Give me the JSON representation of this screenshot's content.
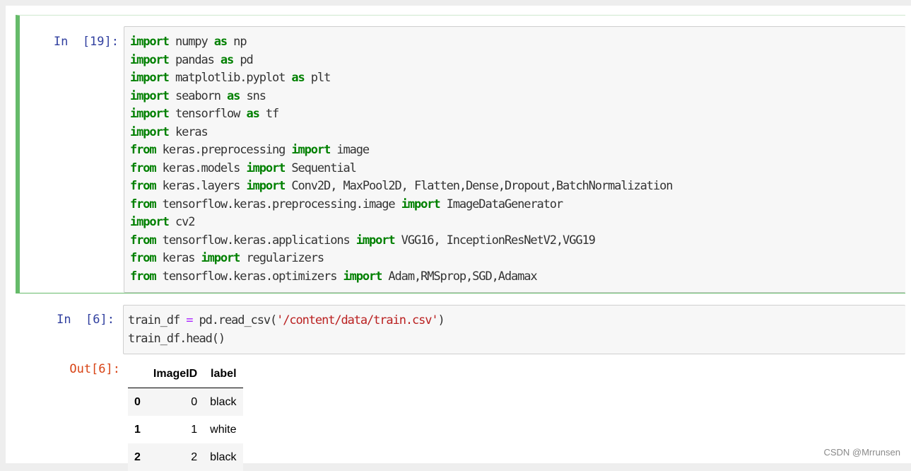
{
  "cells": [
    {
      "prompt": "In  [19]:",
      "lines": [
        [
          {
            "t": "import",
            "c": "kw"
          },
          {
            "t": " numpy "
          },
          {
            "t": "as",
            "c": "kw"
          },
          {
            "t": " np"
          }
        ],
        [
          {
            "t": "import",
            "c": "kw"
          },
          {
            "t": " pandas "
          },
          {
            "t": "as",
            "c": "kw"
          },
          {
            "t": " pd"
          }
        ],
        [
          {
            "t": "import",
            "c": "kw"
          },
          {
            "t": " matplotlib.pyplot "
          },
          {
            "t": "as",
            "c": "kw"
          },
          {
            "t": " plt"
          }
        ],
        [
          {
            "t": "import",
            "c": "kw"
          },
          {
            "t": " seaborn "
          },
          {
            "t": "as",
            "c": "kw"
          },
          {
            "t": " sns"
          }
        ],
        [
          {
            "t": "import",
            "c": "kw"
          },
          {
            "t": " tensorflow "
          },
          {
            "t": "as",
            "c": "kw"
          },
          {
            "t": " tf"
          }
        ],
        [
          {
            "t": "import",
            "c": "kw"
          },
          {
            "t": " keras"
          }
        ],
        [
          {
            "t": "from",
            "c": "kw"
          },
          {
            "t": " keras.preprocessing "
          },
          {
            "t": "import",
            "c": "kw"
          },
          {
            "t": " image"
          }
        ],
        [
          {
            "t": "from",
            "c": "kw"
          },
          {
            "t": " keras.models "
          },
          {
            "t": "import",
            "c": "kw"
          },
          {
            "t": " Sequential"
          }
        ],
        [
          {
            "t": "from",
            "c": "kw"
          },
          {
            "t": " keras.layers "
          },
          {
            "t": "import",
            "c": "kw"
          },
          {
            "t": " Conv2D, MaxPool2D, Flatten,Dense,Dropout,BatchNormalization"
          }
        ],
        [
          {
            "t": "from",
            "c": "kw"
          },
          {
            "t": " tensorflow.keras.preprocessing.image "
          },
          {
            "t": "import",
            "c": "kw"
          },
          {
            "t": " ImageDataGenerator"
          }
        ],
        [
          {
            "t": "import",
            "c": "kw"
          },
          {
            "t": " cv2"
          }
        ],
        [
          {
            "t": "from",
            "c": "kw"
          },
          {
            "t": " tensorflow.keras.applications "
          },
          {
            "t": "import",
            "c": "kw"
          },
          {
            "t": " VGG16, InceptionResNetV2,VGG19"
          }
        ],
        [
          {
            "t": "from",
            "c": "kw"
          },
          {
            "t": " keras "
          },
          {
            "t": "import",
            "c": "kw"
          },
          {
            "t": " regularizers"
          }
        ],
        [
          {
            "t": "from",
            "c": "kw"
          },
          {
            "t": " tensorflow.keras.optimizers "
          },
          {
            "t": "import",
            "c": "kw"
          },
          {
            "t": " Adam,RMSprop,SGD,Adamax"
          }
        ]
      ]
    },
    {
      "prompt": "In  [6]:",
      "lines": [
        [
          {
            "t": "train_df "
          },
          {
            "t": "=",
            "c": "op"
          },
          {
            "t": " pd.read_csv("
          },
          {
            "t": "'/content/data/train.csv'",
            "c": "str"
          },
          {
            "t": ")"
          }
        ],
        [
          {
            "t": "train_df.head()"
          }
        ]
      ],
      "output_prompt": "Out[6]:",
      "output_table": {
        "columns": [
          "",
          "ImageID",
          "label"
        ],
        "rows": [
          {
            "index": "0",
            "ImageID": "0",
            "label": "black"
          },
          {
            "index": "1",
            "ImageID": "1",
            "label": "white"
          },
          {
            "index": "2",
            "ImageID": "2",
            "label": "black"
          }
        ]
      }
    }
  ],
  "watermark": "CSDN @Mrrunsen",
  "colors": {
    "selected_cell_border": "#66bb6a",
    "in_prompt": "#303f9f",
    "out_prompt": "#d84315",
    "keyword": "#008000",
    "string": "#ba2121",
    "operator": "#aa22ff"
  }
}
